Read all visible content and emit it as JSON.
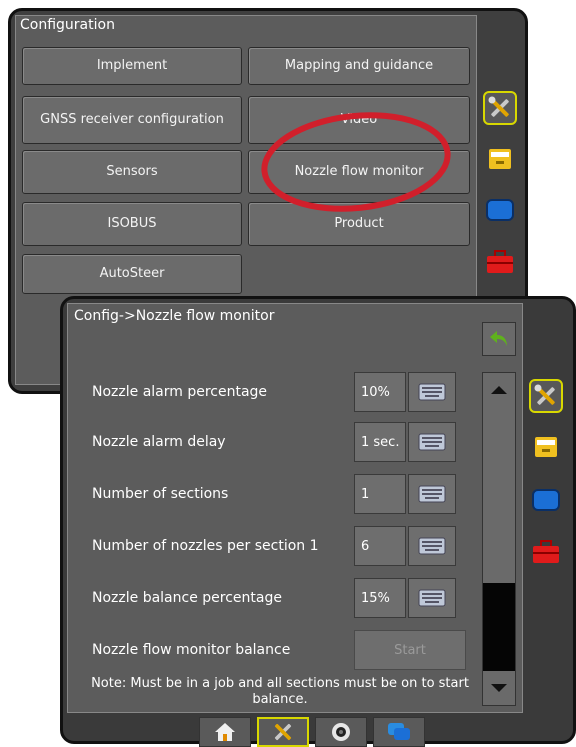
{
  "configuration": {
    "title": "Configuration",
    "buttons": [
      "Implement",
      "Mapping and guidance",
      "GNSS receiver configuration",
      "Video",
      "Sensors",
      "Nozzle flow monitor",
      "ISOBUS",
      "Product",
      "AutoSteer"
    ]
  },
  "nozzle_screen": {
    "title": "Config->Nozzle flow monitor",
    "rows": [
      {
        "label": "Nozzle alarm percentage",
        "value": "10%"
      },
      {
        "label": "Nozzle alarm delay",
        "value": "1 sec."
      },
      {
        "label": "Number of sections",
        "value": "1"
      },
      {
        "label": "Number of nozzles per section 1",
        "value": "6"
      },
      {
        "label": "Nozzle balance percentage",
        "value": "15%"
      }
    ],
    "balance_label": "Nozzle flow monitor balance",
    "start_label": "Start",
    "note": "Note: Must be in a job and all sections must be on to start balance."
  },
  "side_tabs": [
    "tools-icon",
    "drawer-icon",
    "display-icon",
    "toolbox-icon"
  ],
  "bottom_tabs": [
    "home-icon",
    "tools-icon",
    "camera-icon",
    "chat-icon"
  ],
  "colors": {
    "highlight_ring": "#d11f2b",
    "active_tab_border": "#d8d800",
    "back_arrow": "#5fb11d"
  }
}
